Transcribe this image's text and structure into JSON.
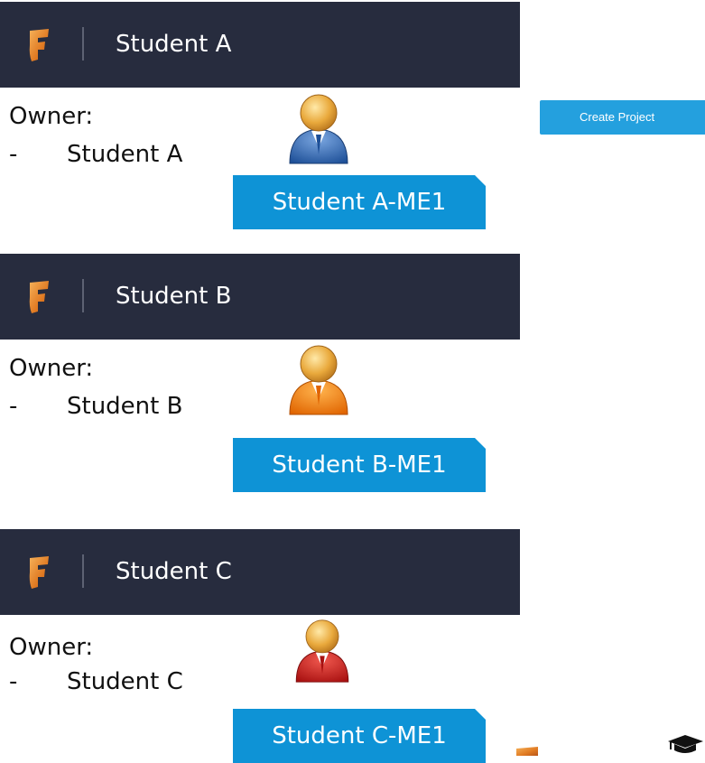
{
  "create_project_label": "Create Project",
  "owner_label": "Owner:",
  "owner_dash": "-",
  "colors": {
    "header_bg": "#272c3e",
    "project_blue": "#0e93d6",
    "button_blue": "#24a0de",
    "logo_orange": "#e8892f"
  },
  "icons": {
    "app_logo": "fusion-f-logo-icon",
    "user": "person-avatar-icon",
    "education": "graduation-cap-icon"
  },
  "students": [
    {
      "header_title": "Student A",
      "owner_name": "Student A",
      "project_label": "Student A-ME1",
      "avatar_color": "blue"
    },
    {
      "header_title": "Student B",
      "owner_name": "Student B",
      "project_label": "Student B-ME1",
      "avatar_color": "orange"
    },
    {
      "header_title": "Student C",
      "owner_name": "Student C",
      "project_label": "Student C-ME1",
      "avatar_color": "red"
    }
  ]
}
